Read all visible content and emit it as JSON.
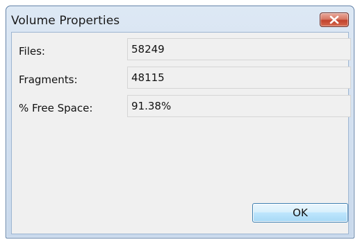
{
  "window": {
    "title": "Volume Properties",
    "close_icon": "close-icon",
    "close_color": "#c7432f"
  },
  "properties": [
    {
      "label": "Files:",
      "value": "58249"
    },
    {
      "label": "Fragments:",
      "value": "48115"
    },
    {
      "label": "% Free Space:",
      "value": "91.38%"
    }
  ],
  "buttons": {
    "ok_label": "OK"
  }
}
